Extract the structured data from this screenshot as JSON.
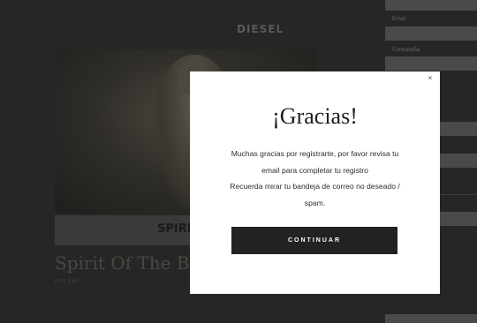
{
  "page": {
    "brand": "DIESEL",
    "product_bar_text": "SPIRIT",
    "product_title": "Spirit Of The Brav",
    "product_brand": "DIESEL",
    "form_labels": [
      "Email",
      "Contraseña"
    ]
  },
  "modal": {
    "close_label": "×",
    "title": "¡Gracias!",
    "body_lines": [
      "Muchas gracias por registrarte, por favor revisa tu",
      "email para completar tu registro",
      "Recuerda mirar tu bandeja de correo no deseado /",
      "spam."
    ],
    "continue_label": "CONTINUAR"
  }
}
